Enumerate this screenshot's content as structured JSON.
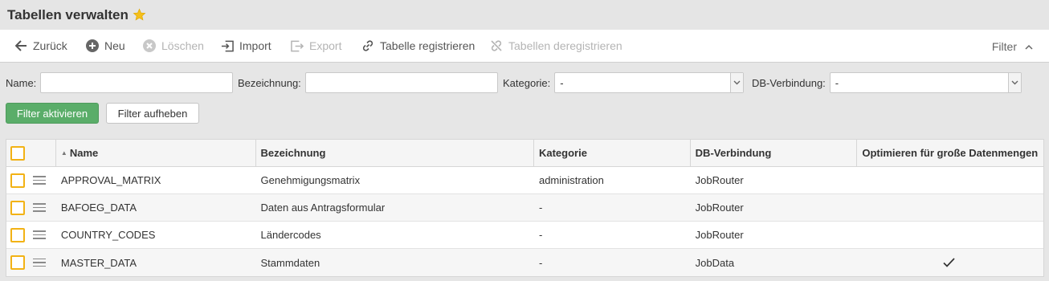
{
  "title": "Tabellen verwalten",
  "toolbar": {
    "back": "Zurück",
    "new": "Neu",
    "delete": "Löschen",
    "import": "Import",
    "export": "Export",
    "register": "Tabelle registrieren",
    "deregister": "Tabellen deregistrieren",
    "filter": "Filter"
  },
  "filters": {
    "name_label": "Name:",
    "name_value": "",
    "bez_label": "Bezeichnung:",
    "bez_value": "",
    "kat_label": "Kategorie:",
    "kat_value": "-",
    "db_label": "DB-Verbindung:",
    "db_value": "-",
    "apply": "Filter aktivieren",
    "reset": "Filter aufheben"
  },
  "table": {
    "headers": [
      "Name",
      "Bezeichnung",
      "Kategorie",
      "DB-Verbindung",
      "Optimieren für große Datenmengen"
    ],
    "sort_indicator": "▲",
    "check_glyph": "✓",
    "rows": [
      {
        "name": "APPROVAL_MATRIX",
        "bez": "Genehmigungsmatrix",
        "kat": "administration",
        "db": "JobRouter",
        "opt": false
      },
      {
        "name": "BAFOEG_DATA",
        "bez": "Daten aus Antragsformular",
        "kat": "-",
        "db": "JobRouter",
        "opt": false
      },
      {
        "name": "COUNTRY_CODES",
        "bez": "Ländercodes",
        "kat": "-",
        "db": "JobRouter",
        "opt": false
      },
      {
        "name": "MASTER_DATA",
        "bez": "Stammdaten",
        "kat": "-",
        "db": "JobData",
        "opt": true
      }
    ]
  },
  "colors": {
    "accent_green": "#5aad69",
    "checkbox_border": "#f2b215",
    "star": "#f5c01b"
  }
}
